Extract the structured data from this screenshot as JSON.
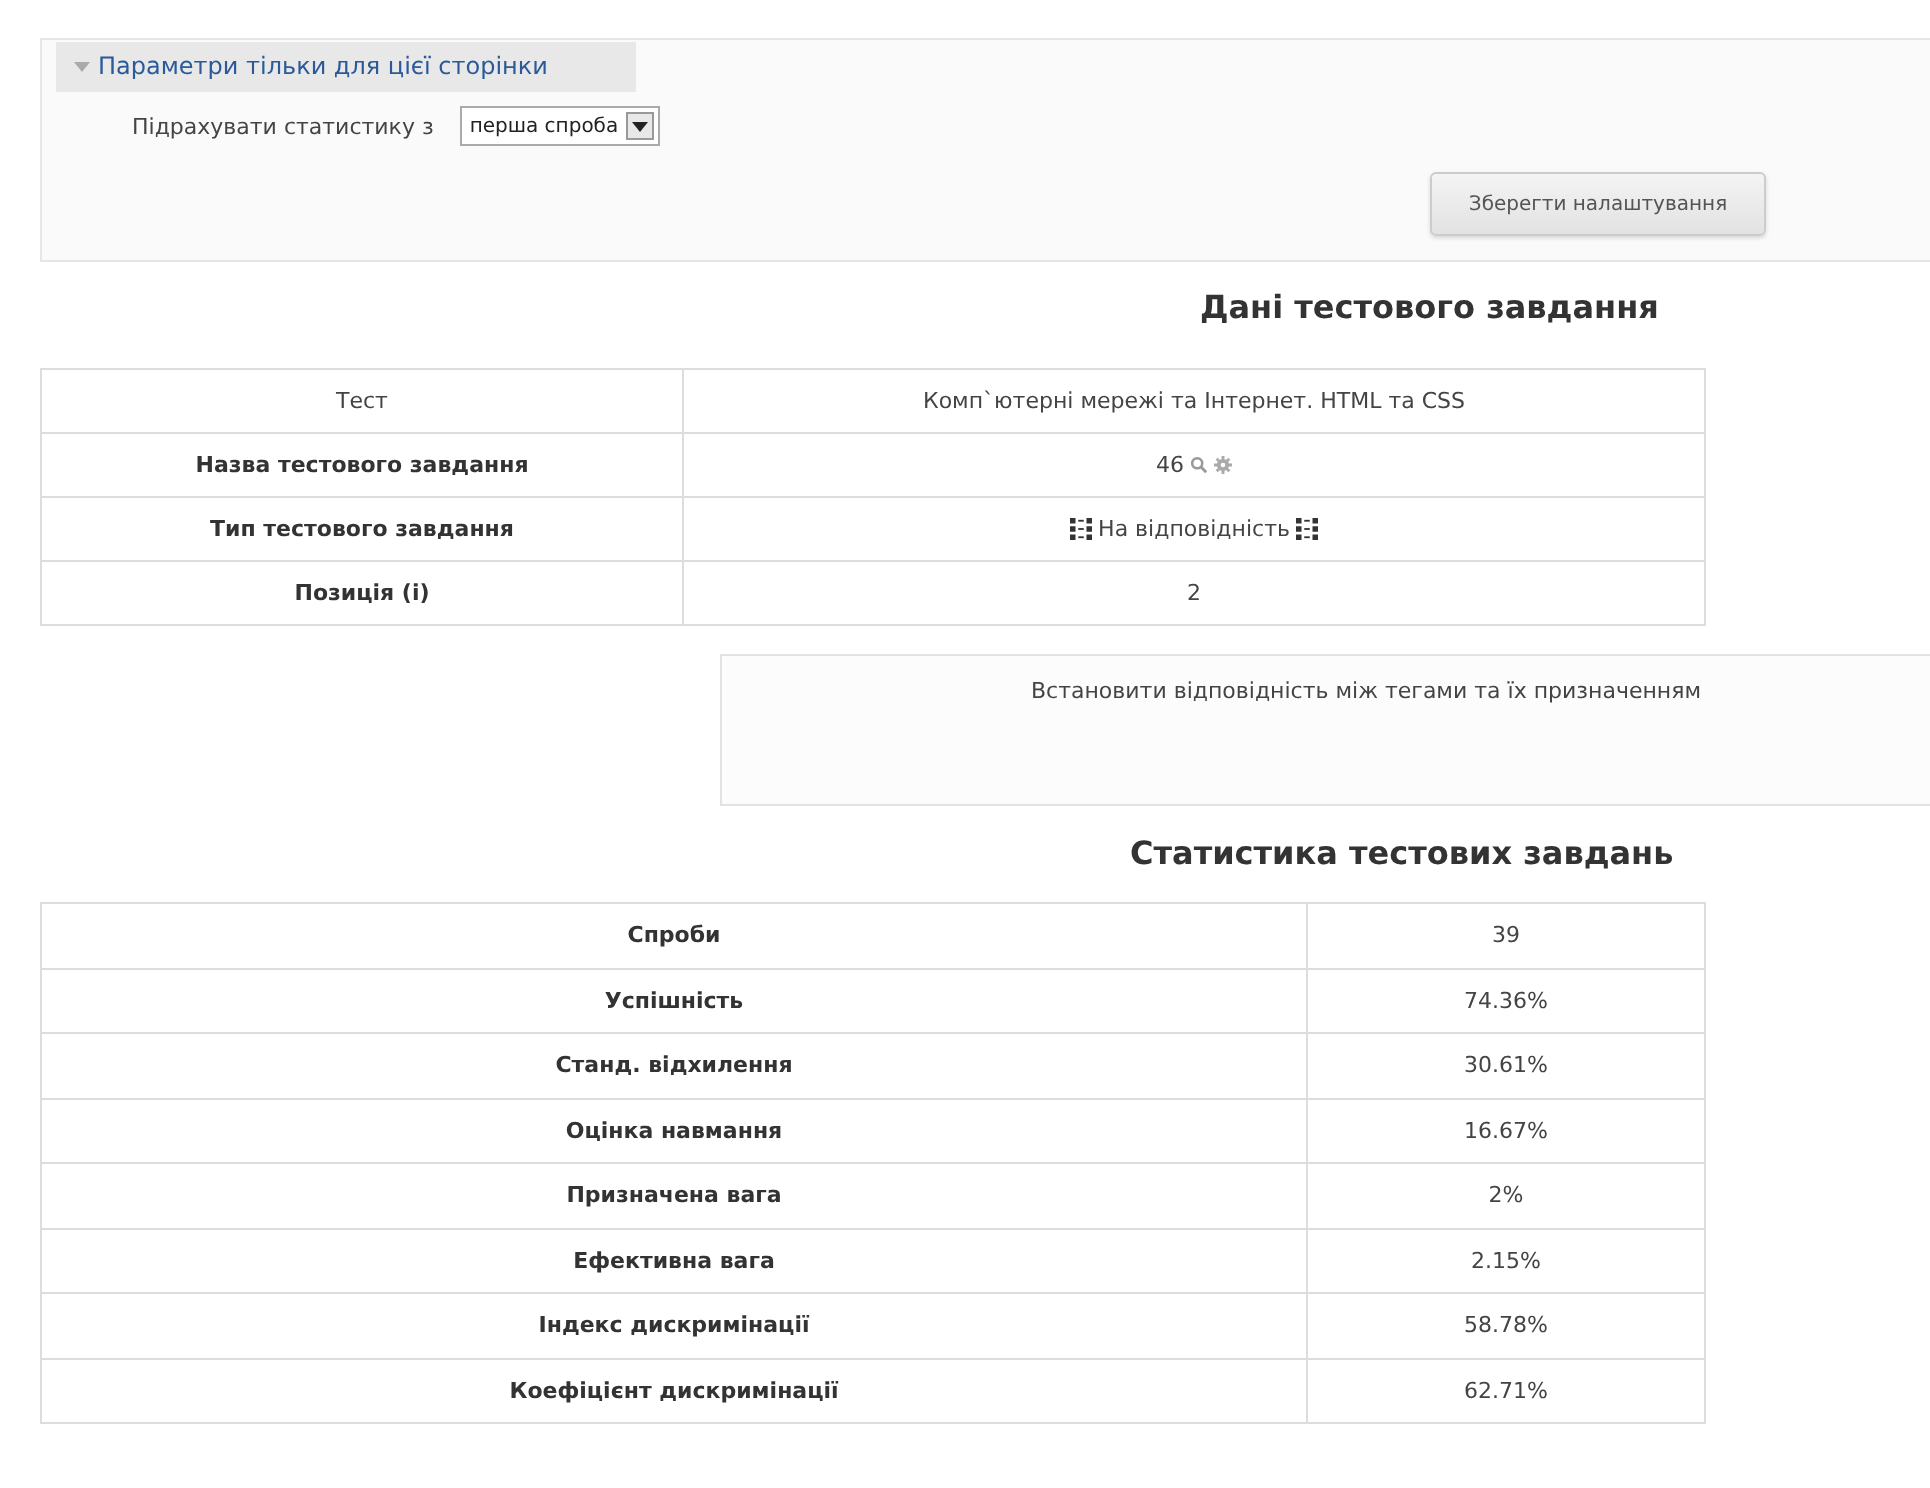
{
  "settings": {
    "legend": "Параметри тільки для цієї сторінки",
    "expanded": true,
    "field_label": "Підрахувати статистику з",
    "select_value": "перша спроба",
    "save_button": "Зберегти налаштування"
  },
  "question_heading": "Дані тестового завдання",
  "question_table": [
    {
      "label": "Тест",
      "value": "Комп`ютерні мережі та Інтернет. HTML та CSS",
      "kind": "text",
      "bold": false
    },
    {
      "label": "Назва тестового завдання",
      "value": "46",
      "kind": "name",
      "bold": true
    },
    {
      "label": "Тип тестового завдання",
      "value": "На відповідність",
      "kind": "type",
      "bold": true
    },
    {
      "label": "Позиція (і)",
      "value": "2",
      "kind": "text",
      "bold": true
    }
  ],
  "question_text": "Встановити відповідність між тегами та їх призначенням",
  "stats_heading": "Статистика тестових завдань",
  "stats_table": [
    {
      "label": "Спроби",
      "value": "39"
    },
    {
      "label": "Успішність",
      "value": "74.36%"
    },
    {
      "label": "Станд. відхилення",
      "value": "30.61%"
    },
    {
      "label": "Оцінка навмання",
      "value": "16.67%"
    },
    {
      "label": "Призначена вага",
      "value": "2%"
    },
    {
      "label": "Ефективна вага",
      "value": "2.15%"
    },
    {
      "label": "Індекс дискримінації",
      "value": "58.78%"
    },
    {
      "label": "Коефіцієнт дискримінації",
      "value": "62.71%"
    }
  ]
}
